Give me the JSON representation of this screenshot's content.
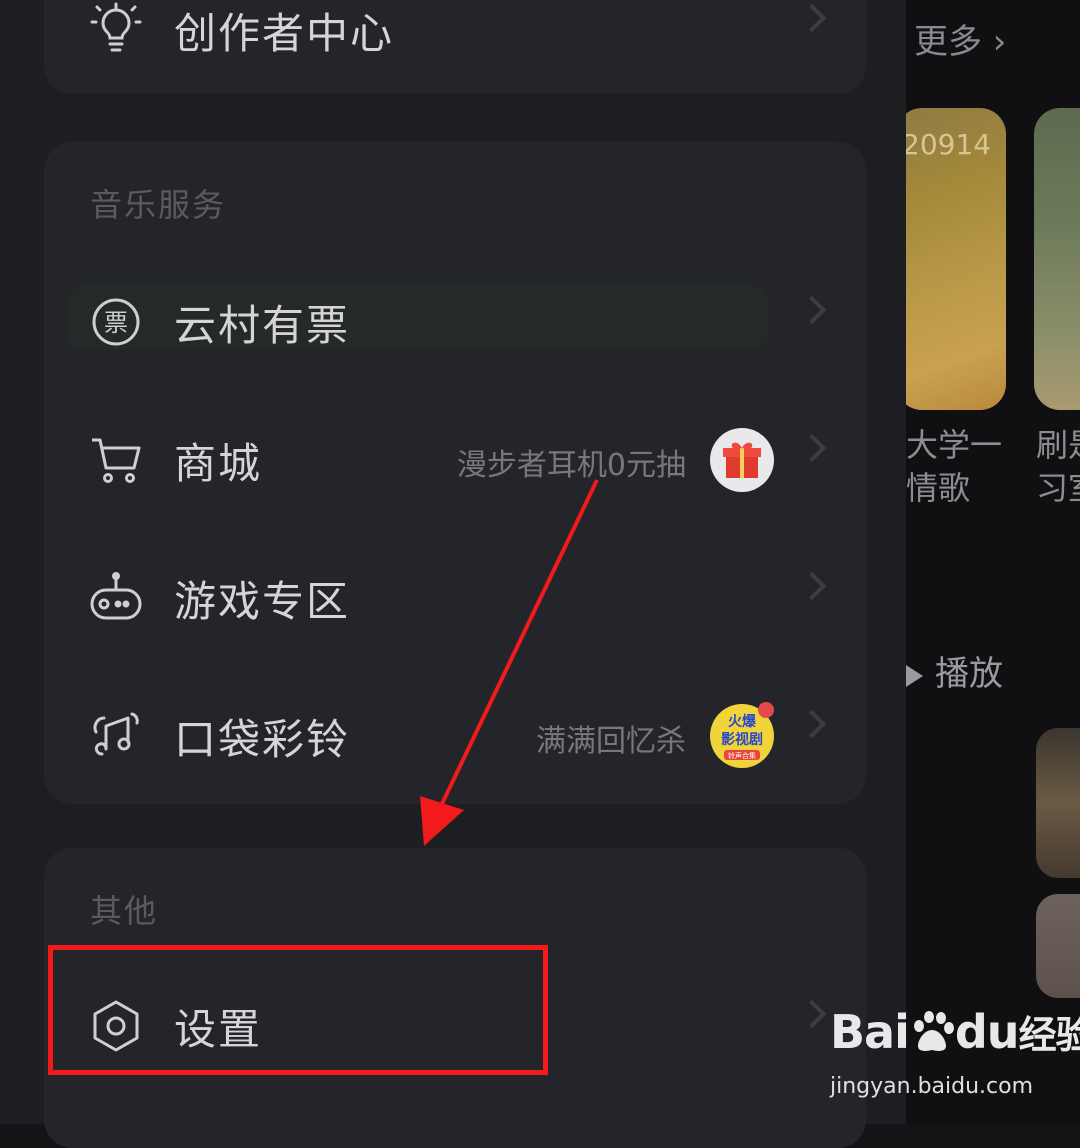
{
  "background": {
    "more_label": "更多",
    "card1_tag": "20914",
    "card1_title_line1": "大学一",
    "card1_title_line2": "情歌",
    "card2_title_line1": "刷是",
    "card2_title_line2": "习室",
    "play_label": "播放"
  },
  "drawer": {
    "top_item": {
      "label": "创作者中心",
      "icon": "lightbulb-icon"
    },
    "music_section": {
      "title": "音乐服务",
      "items": [
        {
          "label": "云村有票",
          "icon": "ticket-icon",
          "hint": ""
        },
        {
          "label": "商城",
          "icon": "cart-icon",
          "hint": "漫步者耳机0元抽",
          "badge": "gift-badge-icon"
        },
        {
          "label": "游戏专区",
          "icon": "game-controller-icon",
          "hint": ""
        },
        {
          "label": "口袋彩铃",
          "icon": "ringtone-icon",
          "hint": "满满回忆杀",
          "badge_text_line1": "火爆",
          "badge_text_line2": "影视剧",
          "badge_text_line3": "铃声合集"
        }
      ]
    },
    "other_section": {
      "title": "其他",
      "items": [
        {
          "label": "设置",
          "icon": "settings-hexagon-icon"
        }
      ]
    }
  },
  "watermark": {
    "logo_text": "Bai",
    "logo_text2": "du",
    "logo_suffix": "经验",
    "url": "jingyan.baidu.com"
  },
  "colors": {
    "annotation_red": "#f21a1a",
    "drawer_bg": "#1d1e21",
    "card_bg": "#24252a"
  }
}
